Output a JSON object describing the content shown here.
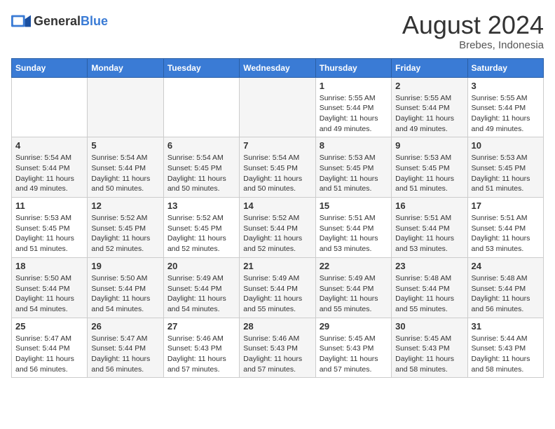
{
  "header": {
    "logo": {
      "general": "General",
      "blue": "Blue"
    },
    "title": "August 2024",
    "subtitle": "Brebes, Indonesia"
  },
  "weekdays": [
    "Sunday",
    "Monday",
    "Tuesday",
    "Wednesday",
    "Thursday",
    "Friday",
    "Saturday"
  ],
  "weeks": [
    [
      {
        "day": "",
        "sunrise": "",
        "sunset": "",
        "daylight": ""
      },
      {
        "day": "",
        "sunrise": "",
        "sunset": "",
        "daylight": ""
      },
      {
        "day": "",
        "sunrise": "",
        "sunset": "",
        "daylight": ""
      },
      {
        "day": "",
        "sunrise": "",
        "sunset": "",
        "daylight": ""
      },
      {
        "day": "1",
        "sunrise": "Sunrise: 5:55 AM",
        "sunset": "Sunset: 5:44 PM",
        "daylight": "Daylight: 11 hours and 49 minutes."
      },
      {
        "day": "2",
        "sunrise": "Sunrise: 5:55 AM",
        "sunset": "Sunset: 5:44 PM",
        "daylight": "Daylight: 11 hours and 49 minutes."
      },
      {
        "day": "3",
        "sunrise": "Sunrise: 5:55 AM",
        "sunset": "Sunset: 5:44 PM",
        "daylight": "Daylight: 11 hours and 49 minutes."
      }
    ],
    [
      {
        "day": "4",
        "sunrise": "Sunrise: 5:54 AM",
        "sunset": "Sunset: 5:44 PM",
        "daylight": "Daylight: 11 hours and 49 minutes."
      },
      {
        "day": "5",
        "sunrise": "Sunrise: 5:54 AM",
        "sunset": "Sunset: 5:44 PM",
        "daylight": "Daylight: 11 hours and 50 minutes."
      },
      {
        "day": "6",
        "sunrise": "Sunrise: 5:54 AM",
        "sunset": "Sunset: 5:45 PM",
        "daylight": "Daylight: 11 hours and 50 minutes."
      },
      {
        "day": "7",
        "sunrise": "Sunrise: 5:54 AM",
        "sunset": "Sunset: 5:45 PM",
        "daylight": "Daylight: 11 hours and 50 minutes."
      },
      {
        "day": "8",
        "sunrise": "Sunrise: 5:53 AM",
        "sunset": "Sunset: 5:45 PM",
        "daylight": "Daylight: 11 hours and 51 minutes."
      },
      {
        "day": "9",
        "sunrise": "Sunrise: 5:53 AM",
        "sunset": "Sunset: 5:45 PM",
        "daylight": "Daylight: 11 hours and 51 minutes."
      },
      {
        "day": "10",
        "sunrise": "Sunrise: 5:53 AM",
        "sunset": "Sunset: 5:45 PM",
        "daylight": "Daylight: 11 hours and 51 minutes."
      }
    ],
    [
      {
        "day": "11",
        "sunrise": "Sunrise: 5:53 AM",
        "sunset": "Sunset: 5:45 PM",
        "daylight": "Daylight: 11 hours and 51 minutes."
      },
      {
        "day": "12",
        "sunrise": "Sunrise: 5:52 AM",
        "sunset": "Sunset: 5:45 PM",
        "daylight": "Daylight: 11 hours and 52 minutes."
      },
      {
        "day": "13",
        "sunrise": "Sunrise: 5:52 AM",
        "sunset": "Sunset: 5:45 PM",
        "daylight": "Daylight: 11 hours and 52 minutes."
      },
      {
        "day": "14",
        "sunrise": "Sunrise: 5:52 AM",
        "sunset": "Sunset: 5:44 PM",
        "daylight": "Daylight: 11 hours and 52 minutes."
      },
      {
        "day": "15",
        "sunrise": "Sunrise: 5:51 AM",
        "sunset": "Sunset: 5:44 PM",
        "daylight": "Daylight: 11 hours and 53 minutes."
      },
      {
        "day": "16",
        "sunrise": "Sunrise: 5:51 AM",
        "sunset": "Sunset: 5:44 PM",
        "daylight": "Daylight: 11 hours and 53 minutes."
      },
      {
        "day": "17",
        "sunrise": "Sunrise: 5:51 AM",
        "sunset": "Sunset: 5:44 PM",
        "daylight": "Daylight: 11 hours and 53 minutes."
      }
    ],
    [
      {
        "day": "18",
        "sunrise": "Sunrise: 5:50 AM",
        "sunset": "Sunset: 5:44 PM",
        "daylight": "Daylight: 11 hours and 54 minutes."
      },
      {
        "day": "19",
        "sunrise": "Sunrise: 5:50 AM",
        "sunset": "Sunset: 5:44 PM",
        "daylight": "Daylight: 11 hours and 54 minutes."
      },
      {
        "day": "20",
        "sunrise": "Sunrise: 5:49 AM",
        "sunset": "Sunset: 5:44 PM",
        "daylight": "Daylight: 11 hours and 54 minutes."
      },
      {
        "day": "21",
        "sunrise": "Sunrise: 5:49 AM",
        "sunset": "Sunset: 5:44 PM",
        "daylight": "Daylight: 11 hours and 55 minutes."
      },
      {
        "day": "22",
        "sunrise": "Sunrise: 5:49 AM",
        "sunset": "Sunset: 5:44 PM",
        "daylight": "Daylight: 11 hours and 55 minutes."
      },
      {
        "day": "23",
        "sunrise": "Sunrise: 5:48 AM",
        "sunset": "Sunset: 5:44 PM",
        "daylight": "Daylight: 11 hours and 55 minutes."
      },
      {
        "day": "24",
        "sunrise": "Sunrise: 5:48 AM",
        "sunset": "Sunset: 5:44 PM",
        "daylight": "Daylight: 11 hours and 56 minutes."
      }
    ],
    [
      {
        "day": "25",
        "sunrise": "Sunrise: 5:47 AM",
        "sunset": "Sunset: 5:44 PM",
        "daylight": "Daylight: 11 hours and 56 minutes."
      },
      {
        "day": "26",
        "sunrise": "Sunrise: 5:47 AM",
        "sunset": "Sunset: 5:44 PM",
        "daylight": "Daylight: 11 hours and 56 minutes."
      },
      {
        "day": "27",
        "sunrise": "Sunrise: 5:46 AM",
        "sunset": "Sunset: 5:43 PM",
        "daylight": "Daylight: 11 hours and 57 minutes."
      },
      {
        "day": "28",
        "sunrise": "Sunrise: 5:46 AM",
        "sunset": "Sunset: 5:43 PM",
        "daylight": "Daylight: 11 hours and 57 minutes."
      },
      {
        "day": "29",
        "sunrise": "Sunrise: 5:45 AM",
        "sunset": "Sunset: 5:43 PM",
        "daylight": "Daylight: 11 hours and 57 minutes."
      },
      {
        "day": "30",
        "sunrise": "Sunrise: 5:45 AM",
        "sunset": "Sunset: 5:43 PM",
        "daylight": "Daylight: 11 hours and 58 minutes."
      },
      {
        "day": "31",
        "sunrise": "Sunrise: 5:44 AM",
        "sunset": "Sunset: 5:43 PM",
        "daylight": "Daylight: 11 hours and 58 minutes."
      }
    ]
  ]
}
